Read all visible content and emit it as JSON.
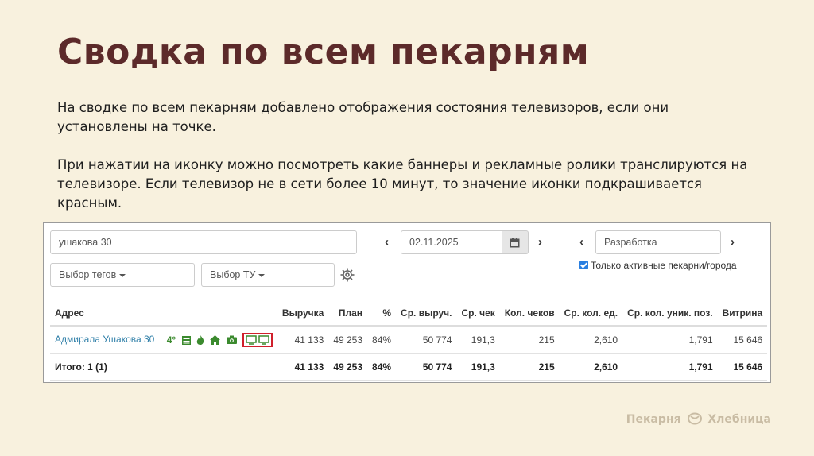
{
  "slide": {
    "title": "Сводка по всем пекарням",
    "paragraph_1": "На сводке по всем пекарням добавлено отображения состояния телевизоров, если они установлены на точке.",
    "paragraph_2": "При нажатии на иконку можно посмотреть какие баннеры и рекламные ролики транслируются на телевизоре. Если телевизор не в сети более 10 минут, то значение иконки подкрашивается красным.",
    "logo_left": "Пекарня",
    "logo_right": "Хлебница"
  },
  "filters": {
    "search_value": "ушакова 30",
    "date_value": "02.11.2025",
    "env_value": "Разработка",
    "tags_select": "Выбор тегов",
    "tu_select": "Выбор ТУ",
    "prev_arrow": "‹",
    "next_arrow": "›",
    "active_only_label": "Только активные пекарни/города",
    "active_only_checked": true
  },
  "table": {
    "columns": [
      "Адрес",
      "Выручка",
      "План",
      "%",
      "Ср. выруч.",
      "Ср. чек",
      "Кол. чеков",
      "Ср. кол. ед.",
      "Ср. кол. уник. поз.",
      "Витрина"
    ],
    "rows": [
      {
        "address": "Адмирала Ушакова 30",
        "temperature": "4°",
        "status_icons": [
          "thermometer-icon",
          "calendar-icon",
          "fire-icon",
          "home-icon",
          "camera-icon",
          "tv-icon",
          "tv-icon"
        ],
        "status_color": "#3b8a2e",
        "tv_alert_color": "#d0202c",
        "cells": [
          "41 133",
          "49 253",
          "84%",
          "50 774",
          "191,3",
          "215",
          "2,610",
          "1,791",
          "15 646"
        ]
      }
    ],
    "total": {
      "label": "Итого: 1 (1)",
      "cells": [
        "41 133",
        "49 253",
        "84%",
        "50 774",
        "191,3",
        "215",
        "2,610",
        "1,791",
        "15 646"
      ]
    }
  }
}
